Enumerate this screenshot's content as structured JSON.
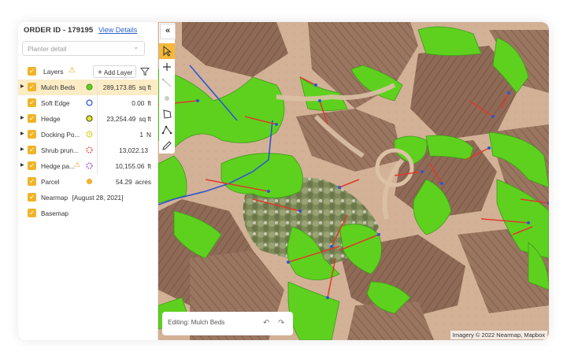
{
  "header": {
    "order_id": "ORDER ID - 179195",
    "view_details": "View Details"
  },
  "dropdown": {
    "selected": "Planter detail"
  },
  "layers": {
    "title": "Layers",
    "add_layer": "Add Layer",
    "items": [
      {
        "name": "Mulch Beds",
        "value": "289,173.85",
        "unit": "sq ft",
        "icon": "filled-circle-green",
        "color": "#5ed11f",
        "selected": true,
        "expandable": true
      },
      {
        "name": "Soft Edge",
        "value": "0.00",
        "unit": "ft",
        "icon": "ring-blue",
        "color": "#2f55d4",
        "selected": false,
        "expandable": false
      },
      {
        "name": "Hedge",
        "value": "23,254.49",
        "unit": "sq ft",
        "icon": "filled-circle-yellow",
        "color": "#e8e224",
        "selected": false,
        "expandable": true
      },
      {
        "name": "Docking Po...",
        "value": "1",
        "unit": "N",
        "icon": "clock-yellow",
        "color": "#d8cc1a",
        "selected": false,
        "expandable": true
      },
      {
        "name": "Shrub prun...",
        "value": "13,022.13",
        "unit": "",
        "icon": "dashed-ring-red",
        "color": "#e0392b",
        "selected": false,
        "expandable": true
      },
      {
        "name": "Hedge pa...",
        "value": "10,155.06",
        "unit": "ft",
        "icon": "dashed-ring-purple",
        "color": "#9b3ad1",
        "selected": false,
        "expandable": true,
        "warning": true
      },
      {
        "name": "Parcel",
        "value": "54.29",
        "unit": "acres",
        "icon": "filled-circle-amber",
        "color": "#f0b429",
        "selected": false,
        "expandable": false
      },
      {
        "name": "Nearmap",
        "value": "[August 28, 2021]",
        "unit": "",
        "icon": "",
        "selected": false,
        "expandable": false
      },
      {
        "name": "Basemap",
        "value": "",
        "unit": "",
        "icon": "",
        "selected": false,
        "expandable": false
      }
    ]
  },
  "map": {
    "editing_label": "Editing: Mulch Beds",
    "attribution": "Imagery © 2022 Nearmap, Mapbox",
    "toolbar": [
      "collapse-icon",
      "pointer-icon",
      "plus-icon",
      "line-icon",
      "point-icon",
      "polygon-icon",
      "vertex-edit-icon",
      "pencil-icon"
    ]
  },
  "colors": {
    "accent": "#f0b429",
    "mulch_green": "#5ed11f",
    "roof": "#8f6a56",
    "link": "#2d63c8"
  }
}
